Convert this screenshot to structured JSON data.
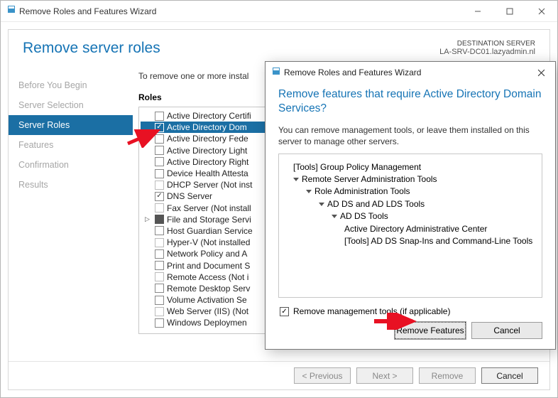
{
  "window": {
    "title": "Remove Roles and Features Wizard",
    "page_title": "Remove server roles",
    "destination_label": "DESTINATION SERVER",
    "destination_value": "LA-SRV-DC01.lazyadmin.nl",
    "intro": "To remove one or more instal",
    "roles_label": "Roles"
  },
  "sidebar": {
    "items": [
      {
        "label": "Before You Begin"
      },
      {
        "label": "Server Selection"
      },
      {
        "label": "Server Roles"
      },
      {
        "label": "Features"
      },
      {
        "label": "Confirmation"
      },
      {
        "label": "Results"
      }
    ],
    "active_index": 2
  },
  "roles": [
    {
      "label": "Active Directory Certifi",
      "checked": false
    },
    {
      "label": "Active Directory Dom",
      "checked": true,
      "selected": true
    },
    {
      "label": "Active Directory Fede",
      "checked": false
    },
    {
      "label": "Active Directory Light",
      "checked": false
    },
    {
      "label": "Active Directory Right",
      "checked": false
    },
    {
      "label": "Device Health Attesta",
      "checked": false
    },
    {
      "label": "DHCP Server (Not inst",
      "checked": false,
      "dim": true
    },
    {
      "label": "DNS Server",
      "checked": true
    },
    {
      "label": "Fax Server (Not install",
      "checked": false,
      "dim": true
    },
    {
      "label": "File and Storage Servi",
      "checked": "partial",
      "expander": true
    },
    {
      "label": "Host Guardian Service",
      "checked": false
    },
    {
      "label": "Hyper-V (Not installed",
      "checked": false,
      "dim": true
    },
    {
      "label": "Network Policy and A",
      "checked": false
    },
    {
      "label": "Print and Document S",
      "checked": false
    },
    {
      "label": "Remote Access (Not i",
      "checked": false,
      "dim": true
    },
    {
      "label": "Remote Desktop Serv",
      "checked": false
    },
    {
      "label": "Volume Activation Se",
      "checked": false
    },
    {
      "label": "Web Server (IIS) (Not",
      "checked": false,
      "dim": true
    },
    {
      "label": "Windows Deploymen",
      "checked": false
    }
  ],
  "footer_buttons": {
    "previous": "< Previous",
    "next": "Next >",
    "remove": "Remove",
    "cancel": "Cancel"
  },
  "dialog": {
    "title": "Remove Roles and Features Wizard",
    "heading": "Remove features that require Active Directory Domain Services?",
    "paragraph": "You can remove management tools, or leave them installed on this server to manage other servers.",
    "tree": [
      {
        "indent": 0,
        "caret": false,
        "label": "[Tools] Group Policy Management"
      },
      {
        "indent": 0,
        "caret": true,
        "label": "Remote Server Administration Tools"
      },
      {
        "indent": 1,
        "caret": true,
        "label": "Role Administration Tools"
      },
      {
        "indent": 2,
        "caret": true,
        "label": "AD DS and AD LDS Tools"
      },
      {
        "indent": 3,
        "caret": true,
        "label": "AD DS Tools"
      },
      {
        "indent": 4,
        "caret": false,
        "label": "Active Directory Administrative Center"
      },
      {
        "indent": 4,
        "caret": false,
        "label": "[Tools] AD DS Snap-Ins and Command-Line Tools"
      }
    ],
    "checkbox_label": "Remove management tools (if applicable)",
    "checkbox_checked": true,
    "primary": "Remove Features",
    "cancel": "Cancel"
  }
}
